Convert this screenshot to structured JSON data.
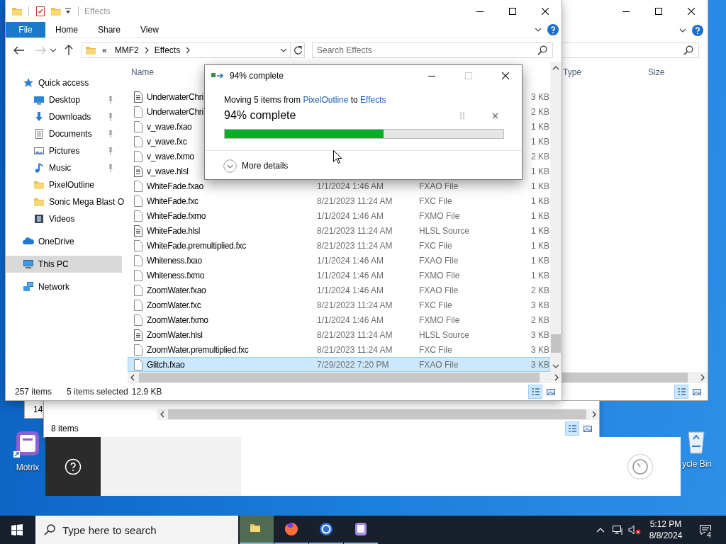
{
  "desktop_icons": [
    {
      "label": "Motrix",
      "kind": "app"
    },
    {
      "label": "ycle Bin",
      "kind": "bin"
    }
  ],
  "window_behind": {
    "status": "14"
  },
  "window_lower": {
    "status": "8 items",
    "views": [
      {
        "selected": true
      },
      {
        "selected": false
      }
    ]
  },
  "back_window": {
    "columns": [
      "Type",
      "Size"
    ],
    "views": [
      {
        "selected": true
      },
      {
        "selected": false
      }
    ]
  },
  "explorer": {
    "title": "Effects",
    "ribbon_tabs": [
      {
        "label": "File",
        "kind": "file"
      },
      {
        "label": "Home",
        "kind": "tab"
      },
      {
        "label": "Share",
        "kind": "tab"
      },
      {
        "label": "View",
        "kind": "tab"
      }
    ],
    "address": {
      "overflow": "«",
      "crumbs": [
        "MMF2",
        "Effects"
      ]
    },
    "search": {
      "placeholder": "Search Effects"
    },
    "nav": [
      {
        "label": "Quick access",
        "kind": "star",
        "selected": false,
        "children": [
          {
            "label": "Desktop",
            "kind": "desktop",
            "pinned": true,
            "selected": false
          },
          {
            "label": "Downloads",
            "kind": "download",
            "pinned": true,
            "selected": false
          },
          {
            "label": "Documents",
            "kind": "documents",
            "pinned": true,
            "selected": false
          },
          {
            "label": "Pictures",
            "kind": "pictures",
            "pinned": true,
            "selected": false
          },
          {
            "label": "Music",
            "kind": "music",
            "pinned": true,
            "selected": false
          },
          {
            "label": "PixelOutline",
            "kind": "folder",
            "pinned": false,
            "selected": false
          },
          {
            "label": "Sonic Mega Blast O",
            "kind": "folder",
            "pinned": false,
            "selected": false
          },
          {
            "label": "Videos",
            "kind": "videos",
            "pinned": false,
            "selected": false
          }
        ]
      },
      {
        "label": "OneDrive",
        "kind": "cloud",
        "selected": false
      },
      {
        "label": "This PC",
        "kind": "pc",
        "selected": true
      },
      {
        "label": "Network",
        "kind": "network",
        "selected": false
      }
    ],
    "columns": [
      "Name"
    ],
    "files": [
      {
        "name": "UnderwaterChri",
        "size": "3 KB",
        "kind": "text",
        "selected": false
      },
      {
        "name": "UnderwaterChri",
        "size": "2 KB",
        "kind": "file",
        "selected": false
      },
      {
        "name": "v_wave.fxao",
        "size": "1 KB",
        "kind": "file",
        "selected": false
      },
      {
        "name": "v_wave.fxc",
        "size": "1 KB",
        "kind": "file",
        "selected": false
      },
      {
        "name": "v_wave.fxmo",
        "size": "2 KB",
        "kind": "file",
        "selected": false
      },
      {
        "name": "v_wave.hlsl",
        "size": "1 KB",
        "kind": "text",
        "selected": false
      },
      {
        "name": "WhiteFade.fxao",
        "date": "1/1/2024 1:46 AM",
        "type": "FXAO File",
        "size": "1 KB",
        "kind": "file",
        "selected": false
      },
      {
        "name": "WhiteFade.fxc",
        "date": "8/21/2023 11:24 AM",
        "type": "FXC File",
        "size": "1 KB",
        "kind": "file",
        "selected": false
      },
      {
        "name": "WhiteFade.fxmo",
        "date": "1/1/2024 1:46 AM",
        "type": "FXMO File",
        "size": "1 KB",
        "kind": "file",
        "selected": false
      },
      {
        "name": "WhiteFade.hlsl",
        "date": "8/21/2023 11:24 AM",
        "type": "HLSL Source",
        "size": "1 KB",
        "kind": "text",
        "selected": false
      },
      {
        "name": "WhiteFade.premultiplied.fxc",
        "date": "8/21/2023 11:24 AM",
        "type": "FXC File",
        "size": "1 KB",
        "kind": "file",
        "selected": false
      },
      {
        "name": "Whiteness.fxao",
        "date": "1/1/2024 1:46 AM",
        "type": "FXAO File",
        "size": "1 KB",
        "kind": "file",
        "selected": false
      },
      {
        "name": "Whiteness.fxmo",
        "date": "1/1/2024 1:46 AM",
        "type": "FXMO File",
        "size": "1 KB",
        "kind": "file",
        "selected": false
      },
      {
        "name": "ZoomWater.fxao",
        "date": "1/1/2024 1:46 AM",
        "type": "FXAO File",
        "size": "2 KB",
        "kind": "file",
        "selected": false
      },
      {
        "name": "ZoomWater.fxc",
        "date": "8/21/2023 11:24 AM",
        "type": "FXC File",
        "size": "3 KB",
        "kind": "file",
        "selected": false
      },
      {
        "name": "ZoomWater.fxmo",
        "date": "1/1/2024 1:46 AM",
        "type": "FXMO File",
        "size": "2 KB",
        "kind": "file",
        "selected": false
      },
      {
        "name": "ZoomWater.hlsl",
        "date": "8/21/2023 11:24 AM",
        "type": "HLSL Source",
        "size": "3 KB",
        "kind": "text",
        "selected": false
      },
      {
        "name": "ZoomWater.premultiplied.fxc",
        "date": "8/21/2023 11:24 AM",
        "type": "FXC File",
        "size": "3 KB",
        "kind": "file",
        "selected": false
      },
      {
        "name": "Glitch.fxao",
        "date": "7/29/2022 7:20 PM",
        "type": "FXAO File",
        "size": "3 KB",
        "kind": "file",
        "selected": true
      }
    ],
    "status": {
      "items": "257 items",
      "selected": "5 items selected",
      "size": "12.9 KB"
    },
    "views": [
      {
        "selected": true
      },
      {
        "selected": false
      }
    ]
  },
  "dialog": {
    "title": "94% complete",
    "message": {
      "prefix": "Moving 5 items from",
      "source": "PixelOutline",
      "joiner": "to",
      "destination": "Effects"
    },
    "status": "94% complete",
    "level": 0.57,
    "details": "More details"
  },
  "taskbar": {
    "search": {
      "placeholder": "Type here to search"
    },
    "apps": [
      {
        "kind": "folder",
        "selected": true
      },
      {
        "kind": "fox",
        "selected": false
      },
      {
        "kind": "ring",
        "selected": false
      },
      {
        "kind": "app",
        "selected": false
      }
    ],
    "clock": {
      "time": "5:12 PM",
      "date": "8/8/2024"
    },
    "notifications": "4"
  }
}
